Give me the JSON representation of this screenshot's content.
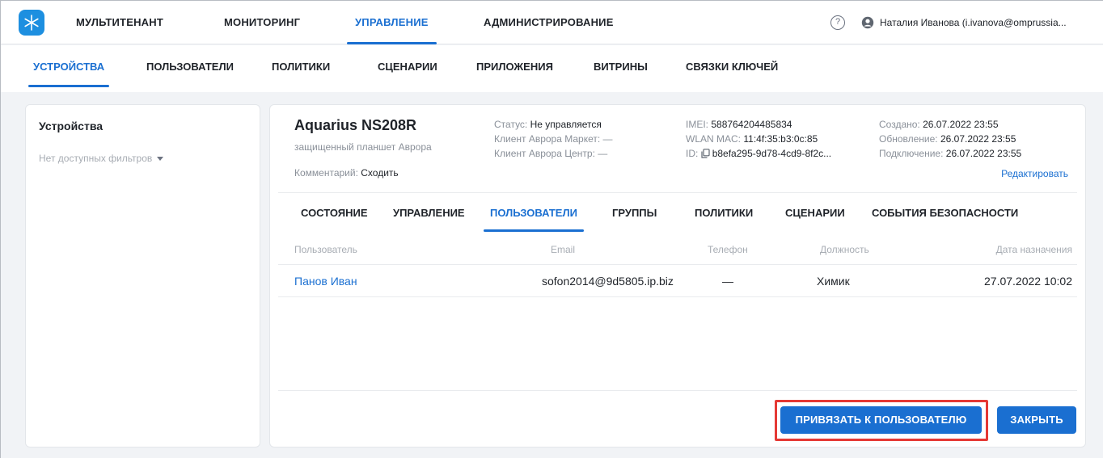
{
  "topnav": {
    "items": [
      "МУЛЬТИТЕНАНТ",
      "МОНИТОРИНГ",
      "УПРАВЛЕНИЕ",
      "АДМИНИСТРИРОВАНИЕ"
    ],
    "active": "УПРАВЛЕНИЕ",
    "help_glyph": "?",
    "user_name": "Наталия Иванова (i.ivanova@omprussia..."
  },
  "subnav": {
    "items": [
      "УСТРОЙСТВА",
      "ПОЛЬЗОВАТЕЛИ",
      "ПОЛИТИКИ",
      "СЦЕНАРИИ",
      "ПРИЛОЖЕНИЯ",
      "ВИТРИНЫ",
      "СВЯЗКИ КЛЮЧЕЙ"
    ],
    "active": "УСТРОЙСТВА"
  },
  "sidebar": {
    "title": "Устройства",
    "filter_text": "Нет доступных фильтров"
  },
  "device": {
    "name": "Aquarius NS208R",
    "subtitle": "защищенный планшет Аврора",
    "comment_label": "Комментарий:",
    "comment_value": "Сходить",
    "status_label": "Статус:",
    "status_value": "Не управляется",
    "market_label": "Клиент Аврора Маркет:",
    "market_value": "—",
    "center_label": "Клиент Аврора Центр:",
    "center_value": "—",
    "imei_label": "IMEI:",
    "imei_value": "588764204485834",
    "wlan_label": "WLAN MAC:",
    "wlan_value": "11:4f:35:b3:0c:85",
    "id_label": "ID:",
    "id_value": "b8efa295-9d78-4cd9-8f2c...",
    "created_label": "Создано:",
    "created_value": "26.07.2022 23:55",
    "updated_label": "Обновление:",
    "updated_value": "26.07.2022 23:55",
    "connected_label": "Подключение:",
    "connected_value": "26.07.2022 23:55",
    "edit_label": "Редактировать"
  },
  "tabs": {
    "items": [
      "СОСТОЯНИЕ",
      "УПРАВЛЕНИЕ",
      "ПОЛЬЗОВАТЕЛИ",
      "ГРУППЫ",
      "ПОЛИТИКИ",
      "СЦЕНАРИИ",
      "СОБЫТИЯ БЕЗОПАСНОСТИ"
    ],
    "active": "ПОЛЬЗОВАТЕЛИ"
  },
  "table": {
    "columns": [
      "Пользователь",
      "Email",
      "Телефон",
      "Должность",
      "Дата назначения"
    ],
    "rows": [
      {
        "user": "Панов Иван",
        "email": "sofon2014@9d5805.ip.biz",
        "phone": "—",
        "position": "Химик",
        "date": "27.07.2022 10:02"
      }
    ]
  },
  "footer": {
    "bind_button": "ПРИВЯЗАТЬ К ПОЛЬЗОВАТЕЛЮ",
    "close_button": "ЗАКРЫТЬ"
  },
  "colors": {
    "accent": "#1a6fd1",
    "highlight": "#e53935",
    "logo": "#1d8fe0"
  }
}
